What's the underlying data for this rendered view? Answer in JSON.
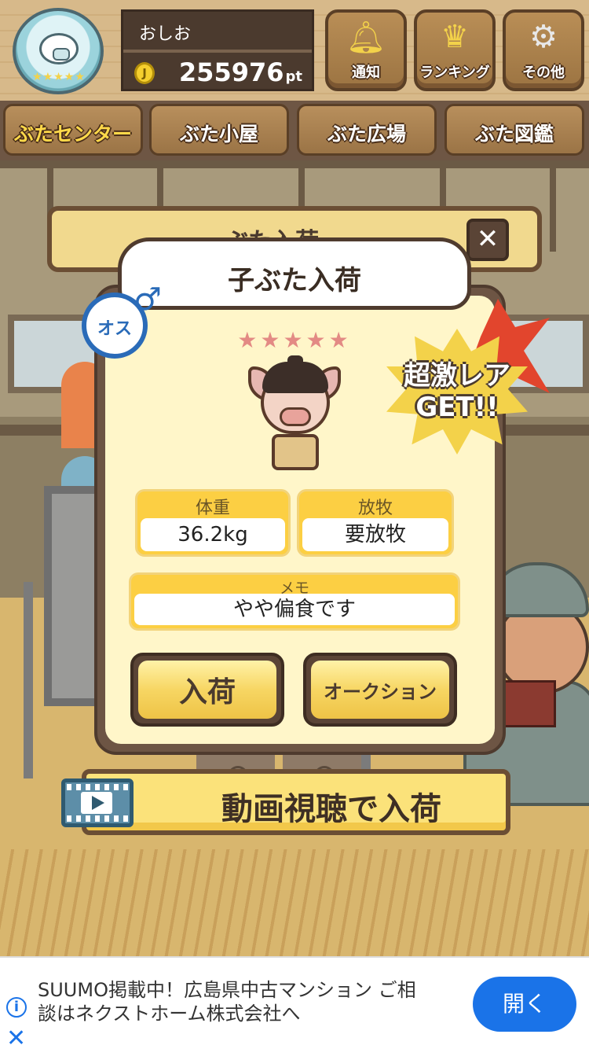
{
  "header": {
    "username": "おしお",
    "coin_symbol": "J",
    "points_value": "255976",
    "points_unit": "pt",
    "buttons": [
      {
        "label": "通知",
        "icon": "bell-icon"
      },
      {
        "label": "ランキング",
        "icon": "crown-icon"
      },
      {
        "label": "その他",
        "icon": "gear-icon"
      }
    ]
  },
  "tabs": [
    {
      "label": "ぶたセンター",
      "active": true
    },
    {
      "label": "ぶた小屋",
      "active": false
    },
    {
      "label": "ぶた広場",
      "active": false
    },
    {
      "label": "ぶた図鑑",
      "active": false
    }
  ],
  "back_panel": {
    "title": "ぶた入荷"
  },
  "close_label": "✕",
  "dialog": {
    "title": "子ぶた入荷",
    "gender_label": "オス",
    "gender_symbol": "♂",
    "rarity_stars": "★★★★★",
    "rarity_burst": {
      "line1": "超激レア",
      "line2": "GET!!"
    },
    "stats": {
      "weight": {
        "label": "体重",
        "value": "36.2kg"
      },
      "grazing": {
        "label": "放牧",
        "value": "要放牧"
      },
      "memo": {
        "label": "メモ",
        "value": "やや偏食です"
      }
    },
    "buttons": {
      "stock": "入荷",
      "auction": "オークション"
    }
  },
  "video_button": {
    "label": "動画視聴で入荷"
  },
  "ad": {
    "text": "SUUMO掲載中！広島県中古マンション ご相談はネクストホーム株式会社へ",
    "open_label": "開く",
    "info_icon": "i",
    "close_icon": "✕"
  },
  "colors": {
    "accent_yellow": "#fccf43",
    "wood_brown": "#6d5544",
    "male_blue": "#2a6bb8",
    "star_pink": "#e38a84",
    "ad_blue": "#1a73e8"
  }
}
